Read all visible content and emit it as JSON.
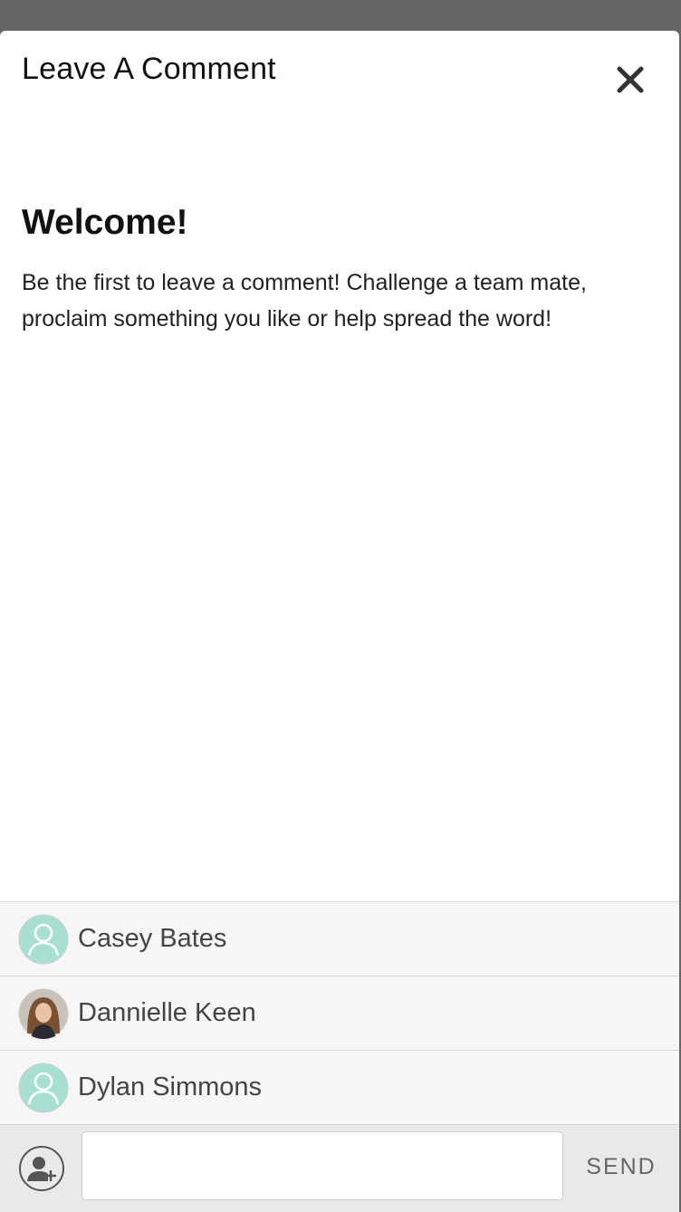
{
  "modal": {
    "title": "Leave A Comment",
    "close_icon": "close-icon"
  },
  "welcome": {
    "heading": "Welcome!",
    "text": "Be the first to leave a comment! Challenge a team mate, proclaim something you like or help spread the word!"
  },
  "mentions": [
    {
      "name": "Casey Bates",
      "avatar": "default-user-icon"
    },
    {
      "name": "Dannielle Keen",
      "avatar": "user-photo"
    },
    {
      "name": "Dylan Simmons",
      "avatar": "default-user-icon"
    }
  ],
  "composer": {
    "add_user_icon": "add-user-icon",
    "input_value": "",
    "input_placeholder": "",
    "send_label": "SEND"
  },
  "colors": {
    "backdrop": "#666666",
    "avatar_default": "#a8dfd3",
    "mention_bg": "#f6f6f6",
    "composer_bg": "#e9e9e9",
    "send_text": "#666666"
  }
}
